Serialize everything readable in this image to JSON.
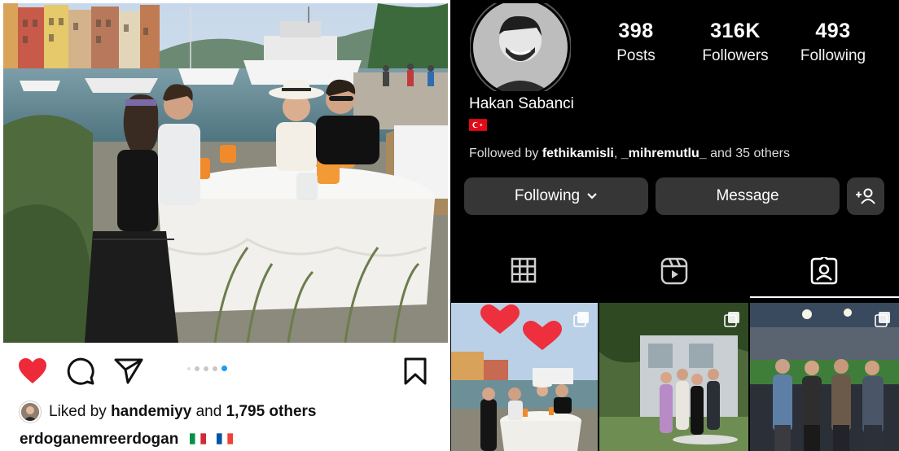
{
  "post": {
    "liked_by_prefix": "Liked by ",
    "liked_by_user": "handemiyy",
    "liked_by_and": " and ",
    "liked_by_others": "1,795 others",
    "caption_user": "erdoganemreerdogan",
    "carousel": {
      "count": 5,
      "active_index": 4
    },
    "icons": [
      "heart-filled-icon",
      "comment-icon",
      "share-icon",
      "bookmark-icon"
    ],
    "colors": {
      "like": "#ed2a3a",
      "active_dot": "#1d9bf0"
    }
  },
  "profile": {
    "stats": [
      {
        "value": "398",
        "label": "Posts"
      },
      {
        "value": "316K",
        "label": "Followers"
      },
      {
        "value": "493",
        "label": "Following"
      }
    ],
    "name": "Hakan Sabanci",
    "followed_by_prefix": "Followed by ",
    "followed_by_user1": "fethikamisli",
    "followed_by_sep": ", ",
    "followed_by_user2": "_mihremutlu_",
    "followed_by_suffix": " and 35 others",
    "buttons": {
      "following": "Following",
      "message": "Message"
    },
    "tabs": [
      "grid-icon",
      "reels-icon",
      "tagged-icon"
    ],
    "active_tab": "tagged",
    "colors": {
      "background": "#000000",
      "button": "#363636",
      "text": "#ffffff"
    }
  }
}
